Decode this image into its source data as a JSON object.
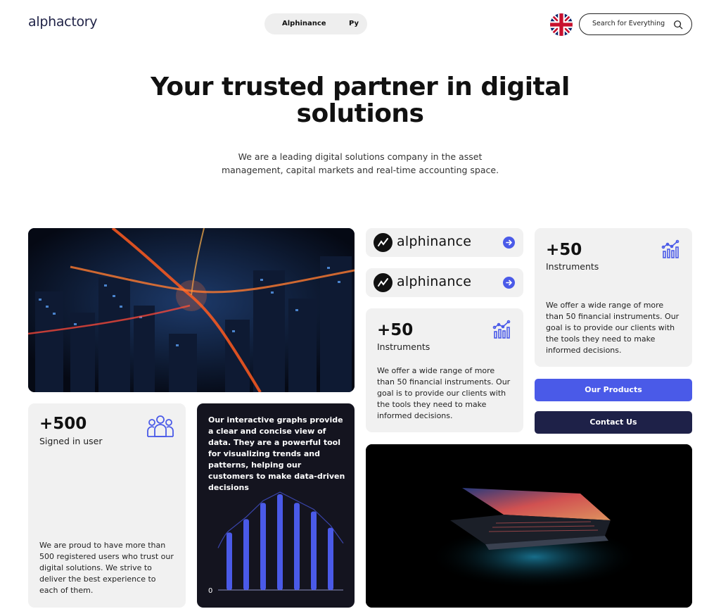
{
  "header": {
    "logo_text": "alphactory",
    "nav": [
      "Alphinance",
      "Py"
    ],
    "language_flag": "uk-flag-icon",
    "search_placeholder": "Search for Everything"
  },
  "hero": {
    "title": "Your trusted partner in digital solutions",
    "subtitle": "We are a leading digital solutions company in the asset management, capital markets and real-time accounting space."
  },
  "products": [
    {
      "name": "alphinance",
      "icon": "arrow-right-icon"
    },
    {
      "name": "alphinance",
      "icon": "arrow-right-icon"
    }
  ],
  "instruments_card": {
    "number": "+50",
    "label": "Instruments",
    "description": "We offer a wide range of more than 50 financial instruments. Our goal is to provide our clients with the tools they need to make informed decisions.",
    "icon": "growth-chart-icon"
  },
  "users_card": {
    "number": "+500",
    "label": "Signed in user",
    "description": "We are proud to have more than 500 registered users who trust our digital solutions. We strive to deliver the best experience to each of them.",
    "icon": "users-group-icon"
  },
  "graph_card": {
    "text": "Our interactive graphs provide a clear and concise view of data. They are a powerful tool for visualizing trends and patterns, helping our customers to make data-driven decisions",
    "zero_label": "0",
    "bar_levels": [
      0.6,
      0.74,
      0.91,
      1.0,
      0.91,
      0.82,
      0.65
    ]
  },
  "buttons": {
    "products": "Our Products",
    "contact": "Contact Us"
  },
  "colors": {
    "accent": "#4a5ae8",
    "navy": "#1e2148",
    "card_gray": "#f1f1f1",
    "dark_card": "#14141f"
  }
}
